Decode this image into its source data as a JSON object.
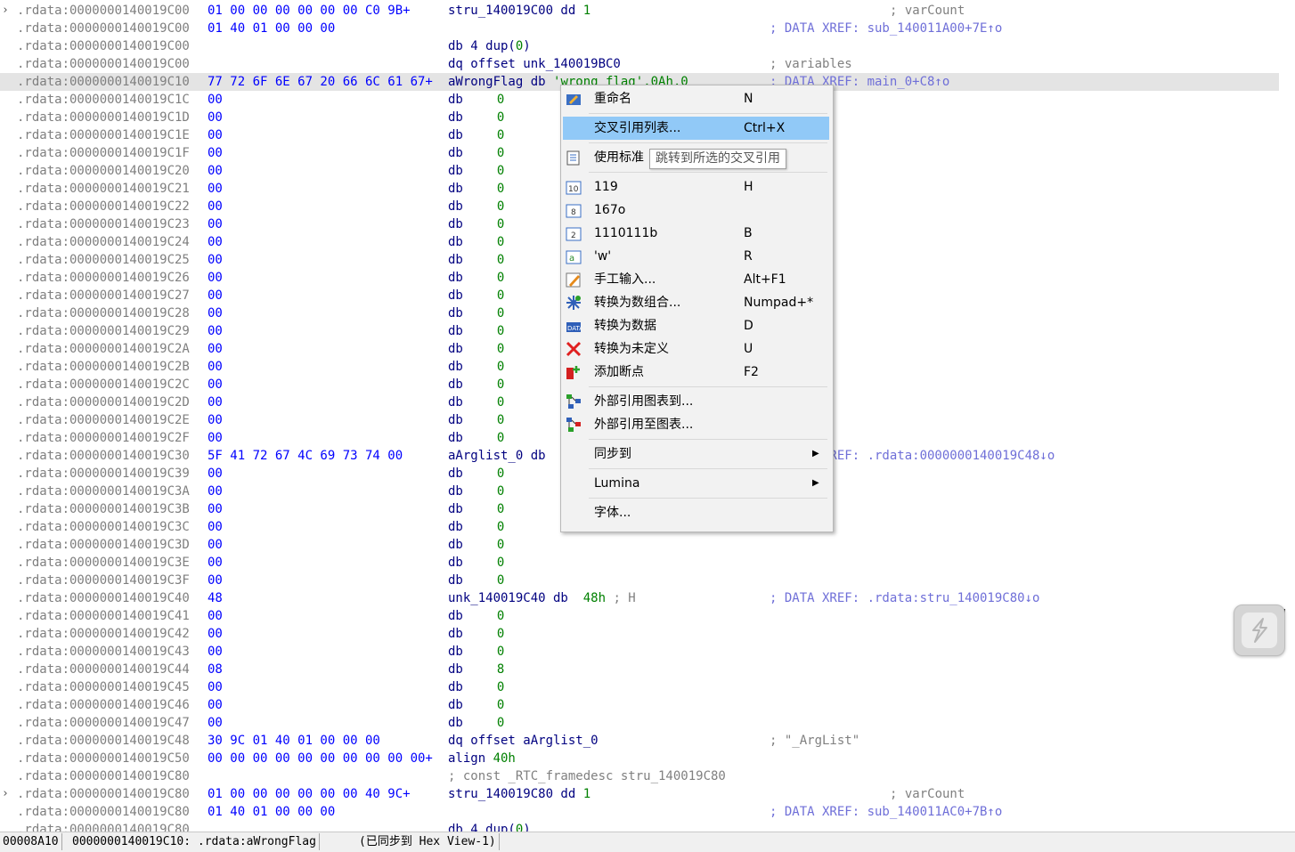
{
  "listing": [
    {
      "expand": true,
      "addr": ".rdata:0000000140019C00",
      "bytes": "01 00 00 00 00 00 00 C0 9B+",
      "label": "stru_140019C00 dd ",
      "operand": "1",
      "comment": "; varCount"
    },
    {
      "addr": ".rdata:0000000140019C00",
      "bytes": "01 40 01 00 00 00",
      "comment": "; DATA XREF: sub_140011A00+7E↑o"
    },
    {
      "addr": ".rdata:0000000140019C00",
      "instr": "db 4 dup(",
      "operand": "0",
      "instr2": ")"
    },
    {
      "addr": ".rdata:0000000140019C00",
      "instr": "dq offset unk_140019BC0",
      "comment": "; variables"
    },
    {
      "selected": true,
      "addr": ".rdata:0000000140019C10",
      "bytes": "77 72 6F 6E 67 20 66 6C 61 67+",
      "label": "aWrongFlag db ",
      "str": "'wrong flag',0Ah,0",
      "comment": "; DATA XREF: main_0+C8↑o"
    },
    {
      "addr": ".rdata:0000000140019C1C",
      "bytes": "00",
      "instr": "db",
      "operand": "0"
    },
    {
      "addr": ".rdata:0000000140019C1D",
      "bytes": "00",
      "instr": "db",
      "operand": "0"
    },
    {
      "addr": ".rdata:0000000140019C1E",
      "bytes": "00",
      "instr": "db",
      "operand": "0"
    },
    {
      "addr": ".rdata:0000000140019C1F",
      "bytes": "00",
      "instr": "db",
      "operand": "0"
    },
    {
      "addr": ".rdata:0000000140019C20",
      "bytes": "00",
      "instr": "db",
      "operand": "0"
    },
    {
      "addr": ".rdata:0000000140019C21",
      "bytes": "00",
      "instr": "db",
      "operand": "0"
    },
    {
      "addr": ".rdata:0000000140019C22",
      "bytes": "00",
      "instr": "db",
      "operand": "0"
    },
    {
      "addr": ".rdata:0000000140019C23",
      "bytes": "00",
      "instr": "db",
      "operand": "0"
    },
    {
      "addr": ".rdata:0000000140019C24",
      "bytes": "00",
      "instr": "db",
      "operand": "0"
    },
    {
      "addr": ".rdata:0000000140019C25",
      "bytes": "00",
      "instr": "db",
      "operand": "0"
    },
    {
      "addr": ".rdata:0000000140019C26",
      "bytes": "00",
      "instr": "db",
      "operand": "0"
    },
    {
      "addr": ".rdata:0000000140019C27",
      "bytes": "00",
      "instr": "db",
      "operand": "0"
    },
    {
      "addr": ".rdata:0000000140019C28",
      "bytes": "00",
      "instr": "db",
      "operand": "0"
    },
    {
      "addr": ".rdata:0000000140019C29",
      "bytes": "00",
      "instr": "db",
      "operand": "0"
    },
    {
      "addr": ".rdata:0000000140019C2A",
      "bytes": "00",
      "instr": "db",
      "operand": "0"
    },
    {
      "addr": ".rdata:0000000140019C2B",
      "bytes": "00",
      "instr": "db",
      "operand": "0"
    },
    {
      "addr": ".rdata:0000000140019C2C",
      "bytes": "00",
      "instr": "db",
      "operand": "0"
    },
    {
      "addr": ".rdata:0000000140019C2D",
      "bytes": "00",
      "instr": "db",
      "operand": "0"
    },
    {
      "addr": ".rdata:0000000140019C2E",
      "bytes": "00",
      "instr": "db",
      "operand": "0"
    },
    {
      "addr": ".rdata:0000000140019C2F",
      "bytes": "00",
      "instr": "db",
      "operand": "0"
    },
    {
      "addr": ".rdata:0000000140019C30",
      "bytes": "5F 41 72 67 4C 69 73 74 00",
      "label": "aArglist_0 db ",
      "comment": "; DATA XREF: .rdata:0000000140019C48↓o"
    },
    {
      "addr": ".rdata:0000000140019C39",
      "bytes": "00",
      "instr": "db",
      "operand": "0"
    },
    {
      "addr": ".rdata:0000000140019C3A",
      "bytes": "00",
      "instr": "db",
      "operand": "0"
    },
    {
      "addr": ".rdata:0000000140019C3B",
      "bytes": "00",
      "instr": "db",
      "operand": "0"
    },
    {
      "addr": ".rdata:0000000140019C3C",
      "bytes": "00",
      "instr": "db",
      "operand": "0"
    },
    {
      "addr": ".rdata:0000000140019C3D",
      "bytes": "00",
      "instr": "db",
      "operand": "0"
    },
    {
      "addr": ".rdata:0000000140019C3E",
      "bytes": "00",
      "instr": "db",
      "operand": "0"
    },
    {
      "addr": ".rdata:0000000140019C3F",
      "bytes": "00",
      "instr": "db",
      "operand": "0"
    },
    {
      "addr": ".rdata:0000000140019C40",
      "bytes": "48",
      "label": "unk_140019C40 db  ",
      "operand": "48h",
      "cmt_inline": " ; H",
      "comment": "; DATA XREF: .rdata:stru_140019C80↓o"
    },
    {
      "addr": ".rdata:0000000140019C41",
      "bytes": "00",
      "instr": "db",
      "operand": "0"
    },
    {
      "addr": ".rdata:0000000140019C42",
      "bytes": "00",
      "instr": "db",
      "operand": "0"
    },
    {
      "addr": ".rdata:0000000140019C43",
      "bytes": "00",
      "instr": "db",
      "operand": "0"
    },
    {
      "addr": ".rdata:0000000140019C44",
      "bytes": "08",
      "instr": "db",
      "operand": "8"
    },
    {
      "addr": ".rdata:0000000140019C45",
      "bytes": "00",
      "instr": "db",
      "operand": "0"
    },
    {
      "addr": ".rdata:0000000140019C46",
      "bytes": "00",
      "instr": "db",
      "operand": "0"
    },
    {
      "addr": ".rdata:0000000140019C47",
      "bytes": "00",
      "instr": "db",
      "operand": "0"
    },
    {
      "addr": ".rdata:0000000140019C48",
      "bytes": "30 9C 01 40 01 00 00 00",
      "instr": "dq offset aArglist_0",
      "comment": "; \"_ArgList\""
    },
    {
      "addr": ".rdata:0000000140019C50",
      "bytes": "00 00 00 00 00 00 00 00 00 00+",
      "instr": "align ",
      "operand": "40h"
    },
    {
      "addr": ".rdata:0000000140019C80",
      "cmt_mid": "; const _RTC_framedesc stru_140019C80"
    },
    {
      "expand": true,
      "addr": ".rdata:0000000140019C80",
      "bytes": "01 00 00 00 00 00 00 40 9C+",
      "label": "stru_140019C80 dd ",
      "operand": "1",
      "comment": "; varCount"
    },
    {
      "addr": ".rdata:0000000140019C80",
      "bytes": "01 40 01 00 00 00",
      "comment": "; DATA XREF: sub_140011AC0+7B↑o"
    },
    {
      "addr": ".rdata:0000000140019C80",
      "instr": "db 4 dup(",
      "operand": "0",
      "instr2": ")"
    }
  ],
  "menu": {
    "items": [
      {
        "name": "rename",
        "label": "重命名",
        "key": "N",
        "icon": "rename-icon"
      },
      {
        "sep": true
      },
      {
        "name": "xref-list",
        "label": "交叉引用列表...",
        "key": "Ctrl+X",
        "icon": "none",
        "highlighted": true
      },
      {
        "sep": true
      },
      {
        "name": "use-standard",
        "label": "使用标准",
        "key": "",
        "icon": "struct-offset-icon"
      },
      {
        "sep": true
      },
      {
        "name": "decimal",
        "label": "119",
        "key": "H",
        "icon": "decimal-icon"
      },
      {
        "name": "octal",
        "label": "167o",
        "key": "",
        "icon": "octal-icon"
      },
      {
        "name": "binary",
        "label": "1110111b",
        "key": "B",
        "icon": "binary-icon"
      },
      {
        "name": "char",
        "label": "'w'",
        "key": "R",
        "icon": "char-icon"
      },
      {
        "name": "manual",
        "label": "手工输入...",
        "key": "Alt+F1",
        "icon": "pencil-icon"
      },
      {
        "name": "array",
        "label": "转换为数组合...",
        "key": "Numpad+*",
        "icon": "array-icon"
      },
      {
        "name": "data",
        "label": "转换为数据",
        "key": "D",
        "icon": "data-icon"
      },
      {
        "name": "undefine",
        "label": "转换为未定义",
        "key": "U",
        "icon": "undefine-x-icon"
      },
      {
        "name": "breakpoint",
        "label": "添加断点",
        "key": "F2",
        "icon": "breakpoint-icon"
      },
      {
        "sep": true
      },
      {
        "name": "xref-graph-to",
        "label": "外部引用图表到...",
        "key": "",
        "icon": "graph-to-icon"
      },
      {
        "name": "xref-graph-from",
        "label": "外部引用至图表...",
        "key": "",
        "icon": "graph-from-icon"
      },
      {
        "sep": true
      },
      {
        "name": "sync",
        "label": "同步到",
        "key": "",
        "icon": "none",
        "submenu": true
      },
      {
        "sep": true
      },
      {
        "name": "lumina",
        "label": "Lumina",
        "key": "",
        "icon": "none",
        "submenu": true
      },
      {
        "sep": true
      },
      {
        "name": "font",
        "label": "字体...",
        "key": "",
        "icon": "none"
      }
    ],
    "tooltip": "跳转到所选的交叉引用"
  },
  "status": {
    "offset": "00008A10",
    "location": "0000000140019C10: .rdata:aWrongFlag",
    "sync": "(已同步到 Hex View-1)"
  },
  "colors": {
    "selection_bg": "#e4e4e4",
    "menu_highlight": "#91c9f7"
  }
}
